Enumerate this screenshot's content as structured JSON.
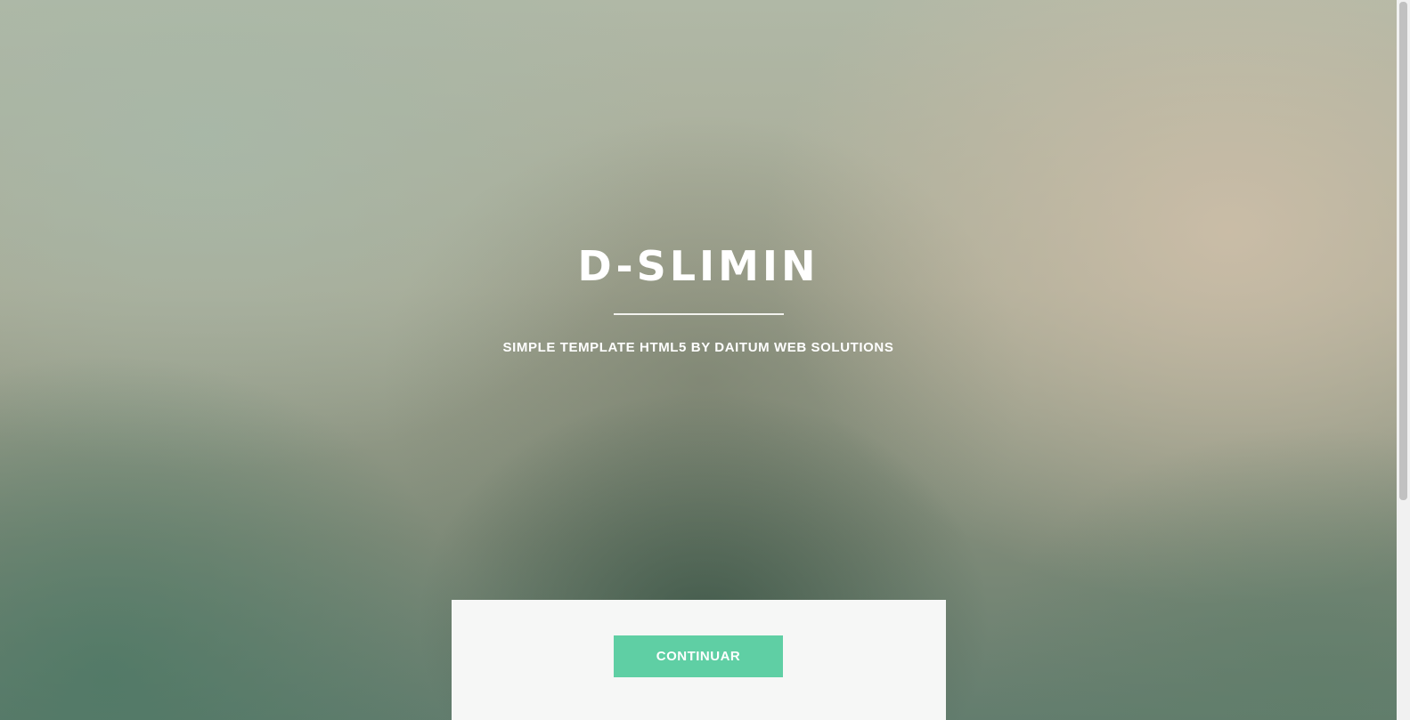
{
  "hero": {
    "title": "D-SLIMIN",
    "subtitle": "SIMPLE TEMPLATE HTML5 BY DAITUM WEB SOLUTIONS"
  },
  "card": {
    "button_label": "CONTINUAR"
  },
  "colors": {
    "accent": "#5fcfa4",
    "card_background": "#f6f7f6",
    "text_light": "#ffffff"
  }
}
